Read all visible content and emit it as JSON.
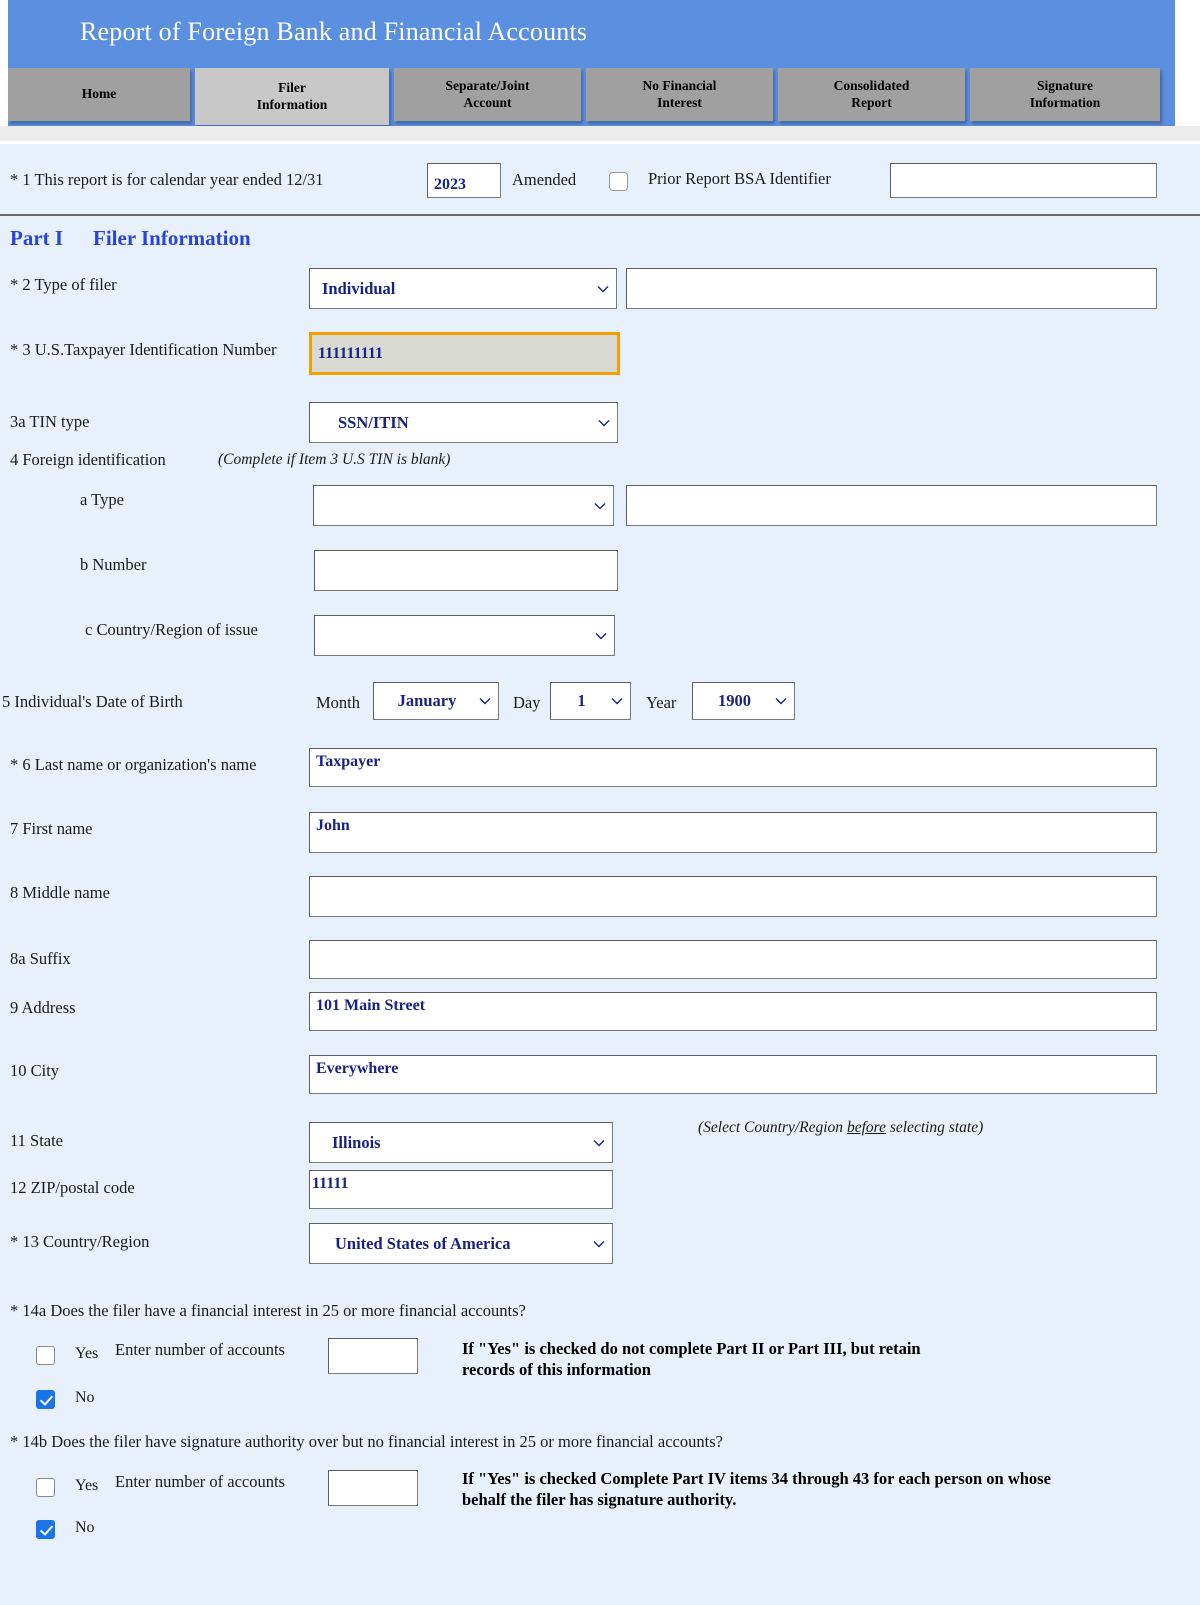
{
  "header": {
    "title": "Report of Foreign Bank and Financial Accounts",
    "band_color": "#5b8fe0"
  },
  "tabs": [
    {
      "name": "home",
      "line1": "Home",
      "line2": "",
      "active": false
    },
    {
      "name": "filer-information",
      "line1": "Filer",
      "line2": "Information",
      "active": true
    },
    {
      "name": "separate-joint-account",
      "line1": "Separate/Joint",
      "line2": "Account",
      "active": false
    },
    {
      "name": "no-financial-interest",
      "line1": "No Financial",
      "line2": "Interest",
      "active": false
    },
    {
      "name": "consolidated-report",
      "line1": "Consolidated",
      "line2": "Report",
      "active": false
    },
    {
      "name": "signature-information",
      "line1": "Signature",
      "line2": "Information",
      "active": false
    }
  ],
  "item1": {
    "label": "* 1  This report is for calendar year ended 12/31",
    "year_value": "2023",
    "amended_label": "Amended",
    "amended_checked": false,
    "prior_bsa_label": "Prior Report BSA Identifier",
    "prior_bsa_value": ""
  },
  "part": {
    "number": "Part I",
    "title": "Filer Information"
  },
  "item2": {
    "label": "* 2 Type of filer",
    "value": "Individual",
    "other_value": ""
  },
  "item3": {
    "label": "* 3 U.S.Taxpayer Identification Number",
    "value": "111111111",
    "focus_color": "#f0a000"
  },
  "item3a": {
    "label": "3a TIN type",
    "value": "SSN/ITIN"
  },
  "item4": {
    "label": "4 Foreign identification",
    "note": "(Complete if Item 3 U.S TIN is blank)",
    "a_label": "a Type",
    "a_value": "",
    "a_other_value": "",
    "b_label": "b Number",
    "b_value": "",
    "c_label": "c Country/Region of issue",
    "c_value": ""
  },
  "item5": {
    "label": "5 Individual's Date of Birth",
    "month_label": "Month",
    "month_value": "January",
    "day_label": "Day",
    "day_value": "1",
    "year_label": "Year",
    "year_value": "1900"
  },
  "item6": {
    "label": "* 6 Last name  or organization's name",
    "value": "Taxpayer"
  },
  "item7": {
    "label": "7  First name",
    "value": "John"
  },
  "item8": {
    "label": "8  Middle name",
    "value": ""
  },
  "item8a": {
    "label": "8a Suffix",
    "value": ""
  },
  "item9": {
    "label": "9  Address",
    "value": "101 Main Street"
  },
  "item10": {
    "label": "10  City",
    "value": "Everywhere"
  },
  "item11": {
    "label": "11 State",
    "value": "Illinois",
    "hint_prefix": "(Select Country/Region ",
    "hint_emphasis": "before",
    "hint_suffix": "  selecting state)"
  },
  "item12": {
    "label": "12  ZIP/postal code",
    "value": "11111"
  },
  "item13": {
    "label": "* 13 Country/Region",
    "value": "United States of America"
  },
  "item14a": {
    "question": "* 14a  Does the filer have a financial interest in 25 or more financial accounts?",
    "yes_label": "Yes",
    "yes_checked": false,
    "no_label": "No",
    "no_checked": true,
    "enter_label": "Enter  number of accounts",
    "count_value": "",
    "note_line1": "If \"Yes\" is checked  do not complete Part II or Part III, but retain",
    "note_line2": "records of this information"
  },
  "item14b": {
    "question": "* 14b  Does the filer have signature authority over but no financial interest in 25 or more financial accounts?",
    "yes_label": "Yes",
    "yes_checked": false,
    "no_label": "No",
    "no_checked": true,
    "enter_label": "Enter  number of accounts",
    "count_value": "",
    "note_line1": "If \"Yes\" is checked Complete Part IV items 34 through 43 for each person on whose",
    "note_line2": "behalf the filer has signature authority."
  }
}
